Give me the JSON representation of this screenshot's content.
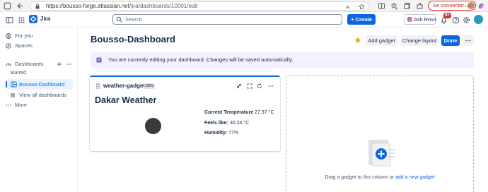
{
  "browser": {
    "url_host": "https://bousso-forge.atlassian.net",
    "url_path": "/jira/dashboards/10001/edit",
    "profile_button": "Se connecter"
  },
  "header": {
    "app_name": "Jira",
    "search_placeholder": "Search",
    "create_label": "+ Create",
    "rovo_label": "Ask Rovo",
    "notification_count": "9+",
    "accent": "#0c66e4"
  },
  "sidebar": {
    "for_you": "For you",
    "spaces": "Spaces",
    "dashboards": "Dashboards",
    "starred": "Starred",
    "active_dashboard": "Bousso-Dashboard",
    "view_all": "View all dashboards",
    "more": "More"
  },
  "main": {
    "title": "Bousso-Dashboard",
    "add_gadget": "Add gadget",
    "change_layout": "Change layout",
    "done": "Done",
    "banner": "You are currently editing your dashboard. Changes will be saved automatically."
  },
  "gadget": {
    "name": "weather-gadget",
    "badge": "DEV",
    "heading": "Dakar Weather",
    "current_label": "Current Temperature",
    "current_value": "27.37 °C",
    "feels_label": "Feels like:",
    "feels_value": "30.24 °C",
    "humidity_label": "Humidity:",
    "humidity_value": "77%"
  },
  "dropzone": {
    "text": "Drag a gadget to this column or ",
    "link": "add a new gadget"
  }
}
